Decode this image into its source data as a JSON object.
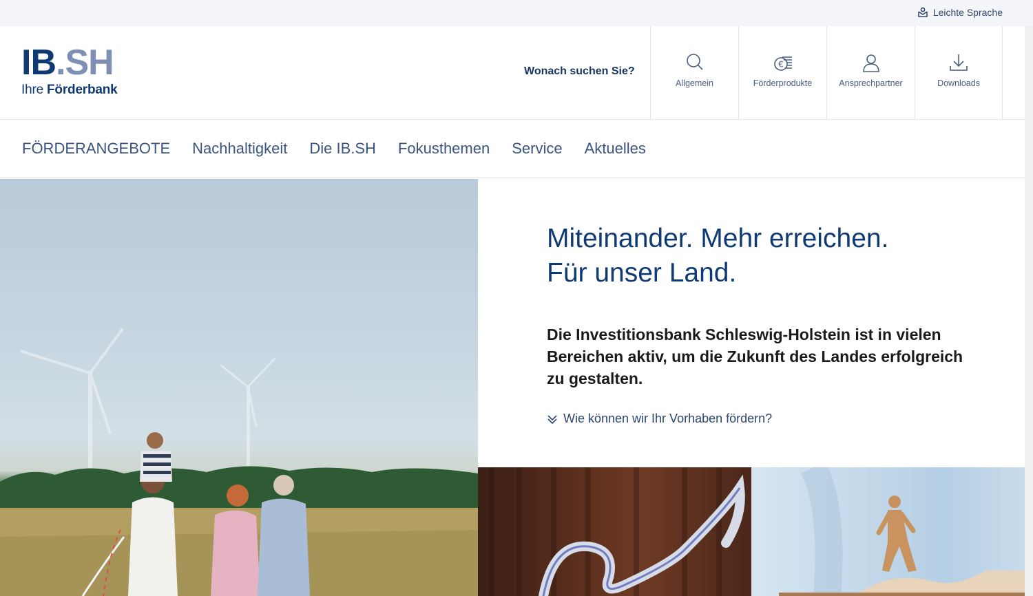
{
  "topbar": {
    "leichte_sprache": "Leichte Sprache"
  },
  "logo": {
    "ib": "IB",
    "dot_sh": ".SH",
    "sub_regular": "Ihre ",
    "sub_bold": "Förderbank"
  },
  "header": {
    "search_label": "Wonach suchen Sie?",
    "quick_links": [
      {
        "label": "Allgemein",
        "icon": "search-icon"
      },
      {
        "label": "Förderprodukte",
        "icon": "euro-coins-icon"
      },
      {
        "label": "Ansprechpartner",
        "icon": "user-icon"
      },
      {
        "label": "Downloads",
        "icon": "download-icon"
      }
    ]
  },
  "nav": {
    "items": [
      "FÖRDERANGEBOTE",
      "Nachhaltigkeit",
      "Die IB.SH",
      "Fokusthemen",
      "Service",
      "Aktuelles"
    ]
  },
  "hero": {
    "title_line1": "Miteinander. Mehr erreichen.",
    "title_line2": "Für unser Land.",
    "body": "Die Investitionsbank Schleswig-Holstein ist in vielen Bereichen aktiv, um die Zukunft des Landes erfolgreich zu gestalten.",
    "link": "Wie können wir Ihr Vorhaben fördern?"
  },
  "colors": {
    "brand_dark": "#0f3a73",
    "brand_light": "#7f8fb3",
    "nav_text": "#3c5480"
  }
}
